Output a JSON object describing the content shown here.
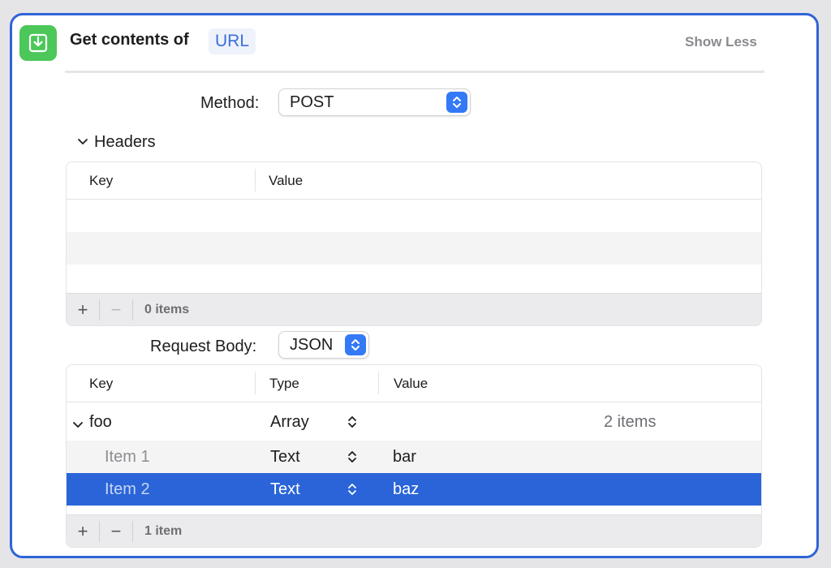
{
  "action": {
    "title": "Get contents of",
    "token": "URL",
    "show_less": "Show Less",
    "icon": "download-icon",
    "accent_color": "#2f64d6",
    "icon_color": "#4cc759"
  },
  "method": {
    "label": "Method:",
    "value": "POST"
  },
  "headers": {
    "label": "Headers",
    "columns": [
      "Key",
      "Value"
    ],
    "count_text": "0 items"
  },
  "request_body": {
    "label": "Request Body:",
    "value": "JSON"
  },
  "body_table": {
    "columns": [
      "Key",
      "Type",
      "Value"
    ],
    "rows": [
      {
        "key": "foo",
        "type": "Array",
        "value": "2 items"
      },
      {
        "key": "Item 1",
        "type": "Text",
        "value": "bar"
      },
      {
        "key": "Item 2",
        "type": "Text",
        "value": "baz"
      }
    ],
    "count_text": "1 item",
    "selected_color": "#2a64d8"
  }
}
